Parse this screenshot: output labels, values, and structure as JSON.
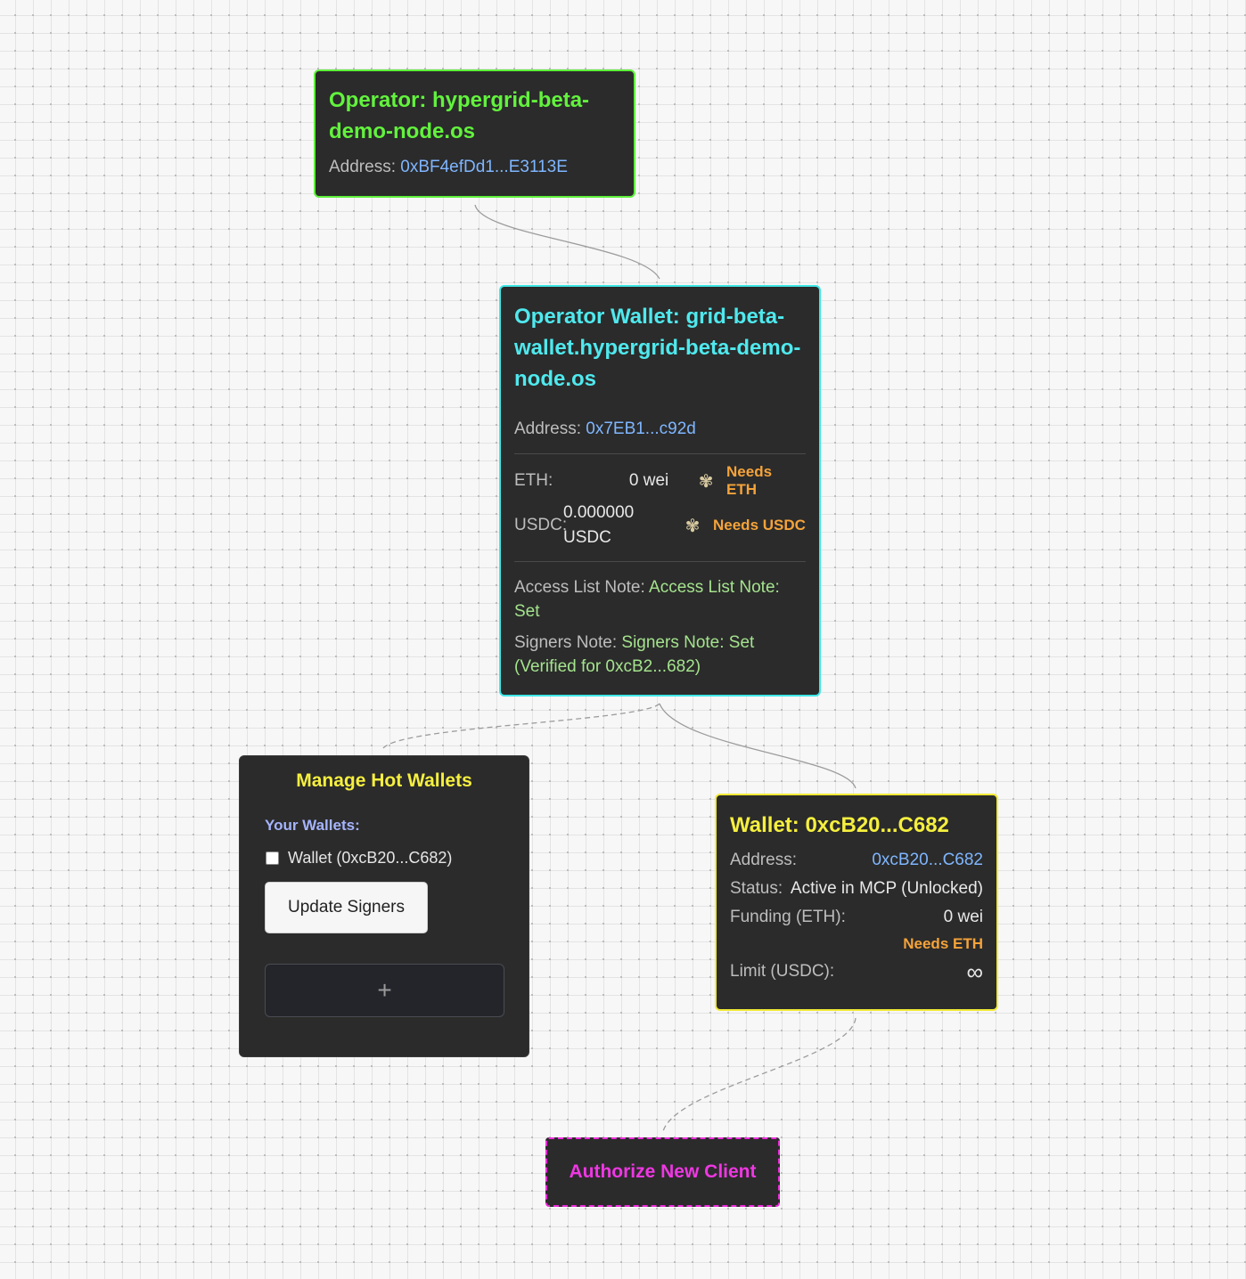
{
  "operator": {
    "title": "Operator: hypergrid-beta-demo-node.os",
    "address_label": "Address:",
    "address": "0xBF4efDd1...E3113E"
  },
  "operator_wallet": {
    "title": "Operator Wallet: grid-beta-wallet.hypergrid-beta-demo-node.os",
    "address_label": "Address:",
    "address": "0x7EB1...c92d",
    "eth_label": "ETH:",
    "eth_value": "0 wei",
    "eth_status": "Needs ETH",
    "usdc_label": "USDC:",
    "usdc_value": "0.000000 USDC",
    "usdc_status": "Needs USDC",
    "status_icon": "faucet-icon",
    "access_list_label": "Access List Note:",
    "access_list_value": "Access List Note: Set",
    "signers_label": "Signers Note:",
    "signers_value": "Signers Note: Set (Verified for 0xcB2...682)"
  },
  "manage_hot_wallets": {
    "title": "Manage Hot Wallets",
    "subtitle": "Your Wallets:",
    "wallets": [
      {
        "label": "Wallet (0xcB20...C682)",
        "checked": false
      }
    ],
    "update_button": "Update Signers",
    "add_button": "+"
  },
  "wallet": {
    "title": "Wallet: 0xcB20...C682",
    "address_label": "Address:",
    "address": "0xcB20...C682",
    "status_label": "Status:",
    "status": "Active in MCP (Unlocked)",
    "funding_label": "Funding (ETH):",
    "funding": "0 wei",
    "funding_status": "Needs ETH",
    "limit_label": "Limit (USDC):",
    "limit": "∞"
  },
  "authorize": {
    "label": "Authorize New Client"
  },
  "colors": {
    "operator_accent": "#5ef03a",
    "operator_wallet_accent": "#3fe6e6",
    "wallet_accent": "#f1ea36",
    "authorize_accent": "#ee2bdd",
    "warning": "#f5a33a",
    "address_link": "#7fb6ff",
    "note_green": "#a4e38d"
  }
}
